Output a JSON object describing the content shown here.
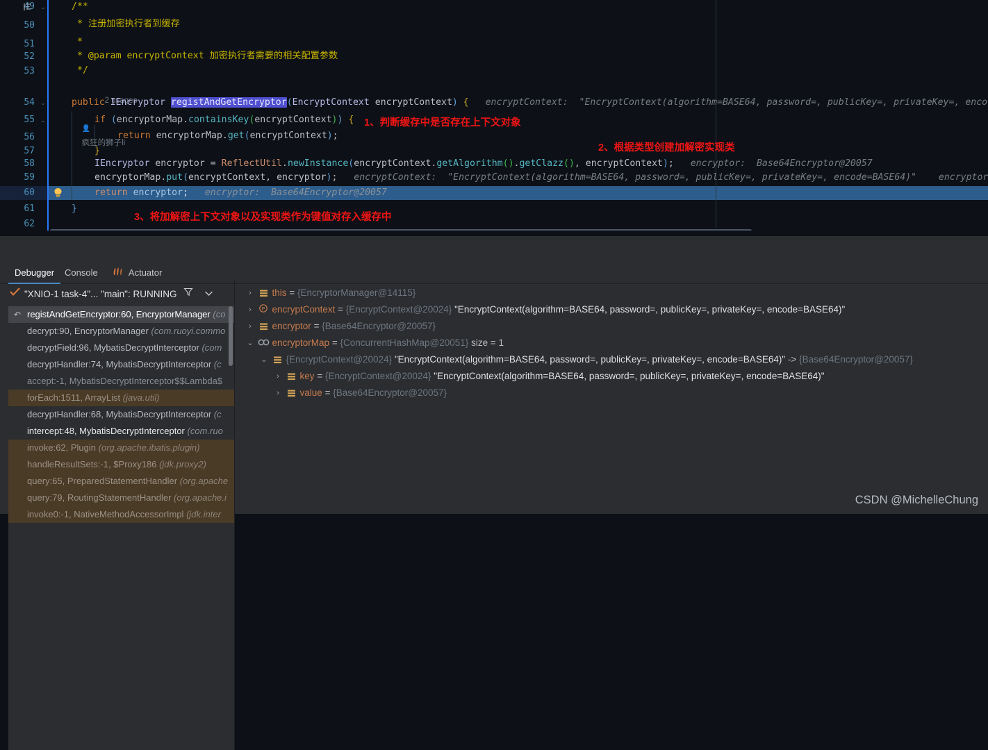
{
  "editor": {
    "lines": [
      {
        "num": "49",
        "fold": "⌄",
        "gutter_icon": "structure-icon"
      },
      {
        "num": "50"
      },
      {
        "num": "51"
      },
      {
        "num": "52"
      },
      {
        "num": "53"
      },
      {
        "num": "",
        "usages": "2 usages",
        "author": "疯狂的狮子li"
      },
      {
        "num": "54",
        "fold": "⌄"
      },
      {
        "num": "55",
        "fold": "⌄"
      },
      {
        "num": "56"
      },
      {
        "num": "57"
      },
      {
        "num": "58"
      },
      {
        "num": "59"
      },
      {
        "num": "60",
        "bulb": "lightbulb-icon",
        "current": true
      },
      {
        "num": "61"
      },
      {
        "num": "62"
      }
    ],
    "code": {
      "l49": "/**",
      "l50_star": "*",
      "l50_text": "注册加密执行者到缓存",
      "l51_star": "*",
      "l52_star": "*",
      "l52_tag": "@param",
      "l52_param": "encryptContext",
      "l52_text": "加密执行者需要的相关配置参数",
      "l53": "*/",
      "usages": "2 usages",
      "author": "疯狂的狮子li",
      "l54_public": "public",
      "l54_type": "IEncryptor",
      "l54_method": "registAndGetEncryptor",
      "l54_argtype": "EncryptContext",
      "l54_argname": "encryptContext",
      "l54_hint": "encryptContext:  \"EncryptContext(algorithm=BASE64, password=, publicKey=, privateKey=, enco",
      "l55_if": "if",
      "l55_obj": "encryptorMap",
      "l55_call": "containsKey",
      "l55_arg": "encryptContext",
      "l56_return": "return",
      "l56_obj": "encryptorMap",
      "l56_call": "get",
      "l56_arg": "encryptContext",
      "l58_type": "IEncryptor",
      "l58_var": "encryptor",
      "l58_cls": "ReflectUtil",
      "l58_m1": "newInstance",
      "l58_obj": "encryptContext",
      "l58_m2": "getAlgorithm",
      "l58_m3": "getClazz",
      "l58_arg": "encryptContext",
      "l58_hint": "encryptor:  Base64Encryptor@20057",
      "l59_obj": "encryptorMap",
      "l59_call": "put",
      "l59_a1": "encryptContext",
      "l59_a2": "encryptor",
      "l59_hint": "encryptContext:  \"EncryptContext(algorithm=BASE64, password=, publicKey=, privateKey=, encode=BASE64)\"",
      "l59_hint2": "encryptor",
      "l60_return": "return",
      "l60_var": "encryptor",
      "l60_hint": "encryptor:  Base64Encryptor@20057"
    },
    "annotations": [
      {
        "id": "a1",
        "text": "1、判断缓存中是否存在上下文对象"
      },
      {
        "id": "a2",
        "text": "2、根据类型创建加解密实现类"
      },
      {
        "id": "a3",
        "text": "3、将加解密上下文对象以及实现类作为键值对存入缓存中"
      }
    ],
    "annotation_color": "#f01414"
  },
  "tool_window": {
    "tabs": [
      {
        "label": "Debugger",
        "active": true,
        "icon": "none"
      },
      {
        "label": "Console",
        "active": false,
        "icon": "none"
      },
      {
        "label": "Actuator",
        "active": false,
        "icon": "actuator-icon"
      }
    ],
    "thread": {
      "status_icon": "check-icon",
      "label": "\"XNIO-1 task-4\"... \"main\": RUNNING",
      "filter_icon": "filter-icon",
      "dropdown_icon": "chevron-down-icon"
    },
    "frames": [
      {
        "text": "registAndGetEncryptor:60, EncryptorManager",
        "pkg": "(co",
        "state": "selected",
        "arrow": "↶"
      },
      {
        "text": "decrypt:90, EncryptorManager",
        "pkg": "(com.ruoyi.commo",
        "state": "normal"
      },
      {
        "text": "decryptField:96, MybatisDecryptInterceptor",
        "pkg": "(com",
        "state": "normal"
      },
      {
        "text": "decryptHandler:74, MybatisDecryptInterceptor",
        "pkg": "(c",
        "state": "normal"
      },
      {
        "text": "accept:-1, MybatisDecryptInterceptor$$Lambda$",
        "pkg": "",
        "state": "dim"
      },
      {
        "text": "forEach:1511, ArrayList",
        "pkg": "(java.util)",
        "state": "lib"
      },
      {
        "text": "decryptHandler:68, MybatisDecryptInterceptor",
        "pkg": "(c",
        "state": "normal"
      },
      {
        "text": "intercept:48, MybatisDecryptInterceptor",
        "pkg": "(com.ruo",
        "state": "bold"
      },
      {
        "text": "invoke:62, Plugin",
        "pkg": "(org.apache.ibatis.plugin)",
        "state": "lib"
      },
      {
        "text": "handleResultSets:-1, $Proxy186",
        "pkg": "(jdk.proxy2)",
        "state": "lib"
      },
      {
        "text": "query:65, PreparedStatementHandler",
        "pkg": "(org.apache",
        "state": "lib"
      },
      {
        "text": "query:79, RoutingStatementHandler",
        "pkg": "(org.apache.i",
        "state": "lib"
      },
      {
        "text": "invoke0:-1, NativeMethodAccessorImpl",
        "pkg": "(jdk.inter",
        "state": "lib"
      }
    ],
    "variables": [
      {
        "indent": 0,
        "twisty": "›",
        "icon": "object-icon",
        "name": "this",
        "eq": "=",
        "ref": "{EncryptorManager@14115}",
        "str": ""
      },
      {
        "indent": 0,
        "twisty": "›",
        "icon": "parameter-icon",
        "name": "encryptContext",
        "eq": "=",
        "ref": "{EncryptContext@20024}",
        "str": "\"EncryptContext(algorithm=BASE64, password=, publicKey=, privateKey=, encode=BASE64)\""
      },
      {
        "indent": 0,
        "twisty": "›",
        "icon": "object-icon",
        "name": "encryptor",
        "eq": "=",
        "ref": "{Base64Encryptor@20057}",
        "str": ""
      },
      {
        "indent": 0,
        "twisty": "⌄",
        "icon": "map-icon",
        "name": "encryptorMap",
        "eq": "=",
        "ref": "{ConcurrentHashMap@20051}",
        "str": "",
        "size": "size = 1"
      },
      {
        "indent": 1,
        "twisty": "⌄",
        "icon": "object-icon",
        "name": "",
        "eq": "",
        "ref": "{EncryptContext@20024}",
        "str": "\"EncryptContext(algorithm=BASE64, password=, publicKey=, privateKey=, encode=BASE64)\"",
        "arrow": "->",
        "ref2": "{Base64Encryptor@20057}"
      },
      {
        "indent": 2,
        "twisty": "›",
        "icon": "object-icon",
        "name": "key",
        "eq": "=",
        "ref": "{EncryptContext@20024}",
        "str": "\"EncryptContext(algorithm=BASE64, password=, publicKey=, privateKey=, encode=BASE64)\""
      },
      {
        "indent": 2,
        "twisty": "›",
        "icon": "object-icon",
        "name": "value",
        "eq": "=",
        "ref": "{Base64Encryptor@20057}",
        "str": ""
      }
    ]
  },
  "watermark": "CSDN @MichelleChung"
}
